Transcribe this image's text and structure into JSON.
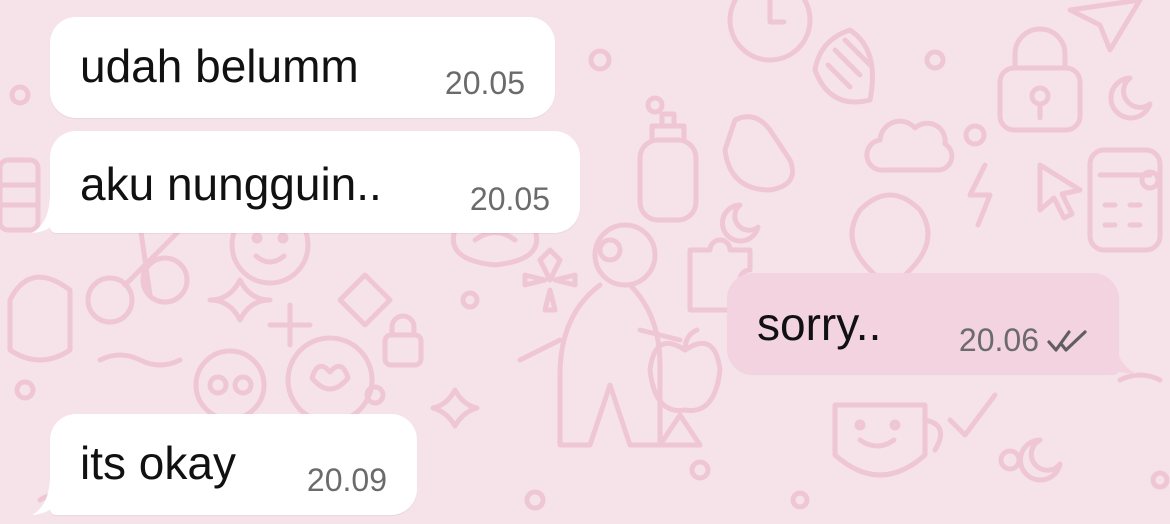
{
  "colors": {
    "background": "#f6e3ea",
    "doodle_stroke": "#efc6d4",
    "incoming_bubble": "#ffffff",
    "outgoing_bubble": "#f3d3df",
    "text": "#111111",
    "timestamp": "#6b6b6b"
  },
  "messages": [
    {
      "direction": "incoming",
      "text": "udah belumm",
      "time": "20.05"
    },
    {
      "direction": "incoming",
      "text": "aku nungguin..",
      "time": "20.05"
    },
    {
      "direction": "outgoing",
      "text": "sorry..",
      "time": "20.06",
      "status_icon": "double-check-icon"
    },
    {
      "direction": "incoming",
      "text": "its okay",
      "time": "20.09"
    }
  ]
}
